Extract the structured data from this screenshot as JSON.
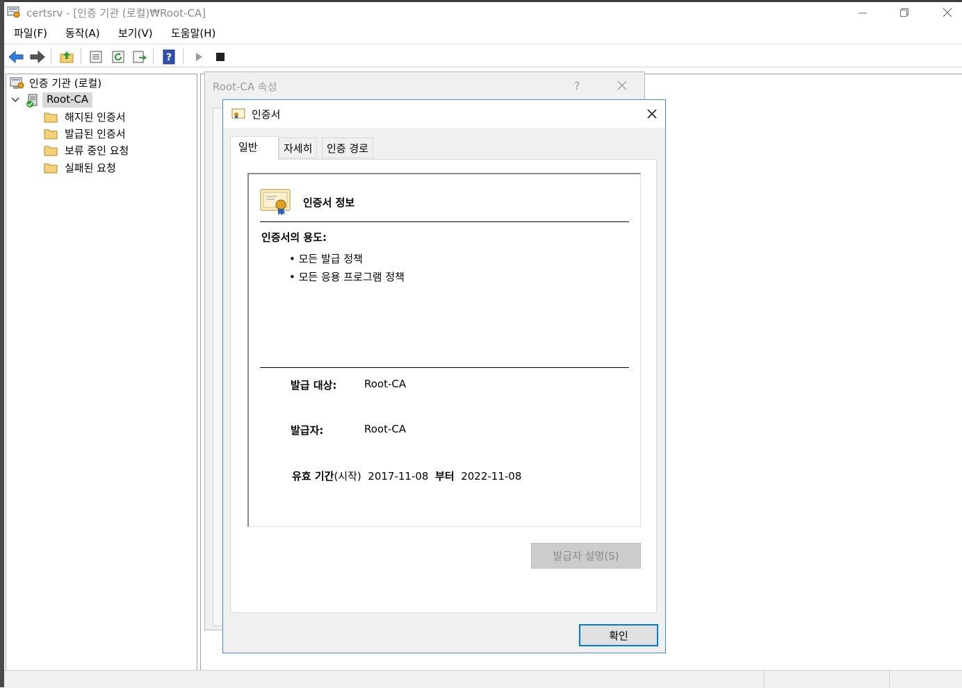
{
  "window": {
    "title": "certsrv - [인증 기관 (로컬)₩Root-CA]"
  },
  "menu": {
    "items": [
      "파일(F)",
      "동작(A)",
      "보기(V)",
      "도움말(H)"
    ]
  },
  "toolbar": {
    "icons": [
      "back-arrow",
      "forward-arrow",
      "up-folder",
      "properties",
      "refresh",
      "export-list",
      "help",
      "play",
      "stop"
    ]
  },
  "tree": {
    "root_label": "인증 기관 (로컬)",
    "ca_label": "Root-CA",
    "folders": [
      "해지된 인증서",
      "발급된 인증서",
      "보류 중인 요청",
      "실패된 요청"
    ]
  },
  "properties_dialog": {
    "title": "Root-CA 속성",
    "help_label": "?"
  },
  "cert_dialog": {
    "title": "인증서",
    "tabs": [
      "일반",
      "자세히",
      "인증 경로"
    ],
    "active_tab": "일반",
    "info_heading": "인증서 정보",
    "purpose_title": "인증서의 용도:",
    "purposes": [
      "모든 발급 정책",
      "모든 응용 프로그램 정책"
    ],
    "issued_to_label": "발급 대상:",
    "issued_to_value": "Root-CA",
    "issued_by_label": "발급자:",
    "issued_by_value": "Root-CA",
    "validity_label": "유효 기간",
    "validity_suffix": "(시작)",
    "valid_from": "2017-11-08",
    "valid_word": "부터",
    "valid_to": "2022-11-08",
    "issuer_statement_label": "발급자 설명(S)",
    "ok_label": "확인"
  },
  "colors": {
    "accent": "#0078d7",
    "dialog_border": "#3c8edb",
    "disabled_button": "#cccccc"
  }
}
